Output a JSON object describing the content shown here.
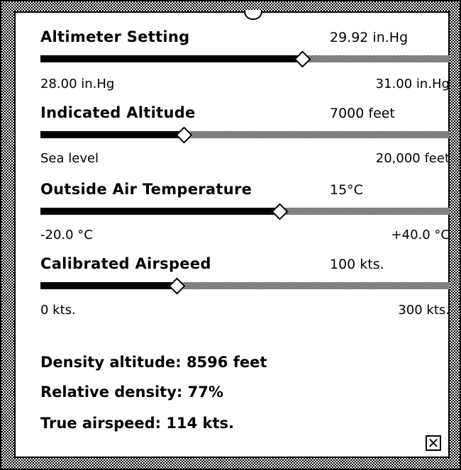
{
  "sliders": [
    {
      "label": "Altimeter Setting",
      "value": "29.92 in.Hg",
      "min_label": "28.00 in.Hg",
      "max_label": "31.00 in.Hg",
      "fraction": 0.64
    },
    {
      "label": "Indicated Altitude",
      "value": "7000 feet",
      "min_label": "Sea level",
      "max_label": "20,000 feet",
      "fraction": 0.35
    },
    {
      "label": "Outside Air Temperature",
      "value": "15°C",
      "min_label": "-20.0 °C",
      "max_label": "+40.0 °C",
      "fraction": 0.5833
    },
    {
      "label": "Calibrated Airspeed",
      "value": "100 kts.",
      "min_label": "0 kts.",
      "max_label": "300 kts.",
      "fraction": 0.3333
    }
  ],
  "results": {
    "density_altitude": "Density altitude: 8596 feet",
    "relative_density": "Relative density: 77%",
    "true_airspeed": "True airspeed: 114 kts."
  },
  "close_glyph": "✕"
}
